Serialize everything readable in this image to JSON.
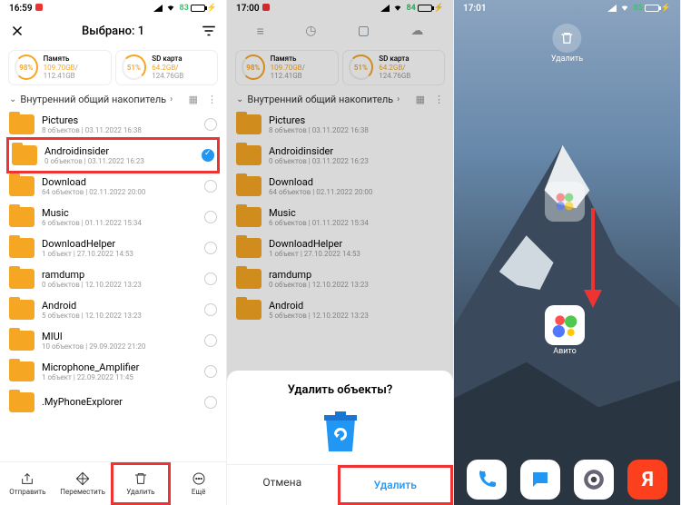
{
  "panel1": {
    "time": "16:59",
    "battery_pct": "83",
    "header_title": "Выбрано: 1",
    "storage": {
      "internal": {
        "pct": "98%",
        "title": "Память",
        "used": "109.70GB",
        "total": "112.41GB"
      },
      "sd": {
        "pct": "51%",
        "title": "SD карта",
        "used": "64.2GB",
        "total": "124.76GB"
      }
    },
    "breadcrumb": "Внутренний общий накопитель",
    "files": [
      {
        "name": "Pictures",
        "meta": "8 объектов | 03.11.2022 16:38",
        "selected": false
      },
      {
        "name": "Androidinsider",
        "meta": "0 объектов | 03.11.2022 16:23",
        "selected": true,
        "highlight": true
      },
      {
        "name": "Download",
        "meta": "64 объектов | 02.11.2022 20:00",
        "selected": false
      },
      {
        "name": "Music",
        "meta": "6 объектов | 01.11.2022 15:34",
        "selected": false
      },
      {
        "name": "DownloadHelper",
        "meta": "1 объект | 27.10.2022 14:53",
        "selected": false
      },
      {
        "name": "ramdump",
        "meta": "0 объектов | 12.10.2022 13:23",
        "selected": false
      },
      {
        "name": "Android",
        "meta": "5 объектов | 12.10.2022 13:23",
        "selected": false
      },
      {
        "name": "MIUI",
        "meta": "10 объектов | 29.09.2022 21:20",
        "selected": false
      },
      {
        "name": "Microphone_Amplifier",
        "meta": "1 объект | 22.09.2022 11:45",
        "selected": false
      },
      {
        "name": ".MyPhoneExplorer",
        "meta": "",
        "selected": false
      }
    ],
    "actions": {
      "send": "Отправить",
      "move": "Переместить",
      "delete": "Удалить",
      "more": "Ещё"
    }
  },
  "panel2": {
    "time": "17:00",
    "battery_pct": "84",
    "storage": {
      "internal": {
        "pct": "98%",
        "title": "Память",
        "used": "109.70GB",
        "total": "112.41GB"
      },
      "sd": {
        "pct": "51%",
        "title": "SD карта",
        "used": "64.2GB",
        "total": "124.76GB"
      }
    },
    "breadcrumb": "Внутренний общий накопитель",
    "files": [
      {
        "name": "Pictures",
        "meta": "8 объектов | 03.11.2022 16:38"
      },
      {
        "name": "Androidinsider",
        "meta": "0 объектов | 03.11.2022 16:23"
      },
      {
        "name": "Download",
        "meta": "64 объектов | 02.11.2022 20:00"
      },
      {
        "name": "Music",
        "meta": "6 объектов | 01.11.2022 15:34"
      },
      {
        "name": "DownloadHelper",
        "meta": "1 объект | 27.10.2022 14:53"
      },
      {
        "name": "ramdump",
        "meta": "0 объектов | 12.10.2022 13:23"
      },
      {
        "name": "Android",
        "meta": "5 объектов | 12.10.2022 13:23"
      }
    ],
    "dialog": {
      "title": "Удалить объекты?",
      "cancel": "Отмена",
      "confirm": "Удалить"
    }
  },
  "panel3": {
    "time": "17:01",
    "battery_pct": "85",
    "delete_label": "Удалить",
    "ghost_label": "",
    "avito_label": "Авито"
  }
}
